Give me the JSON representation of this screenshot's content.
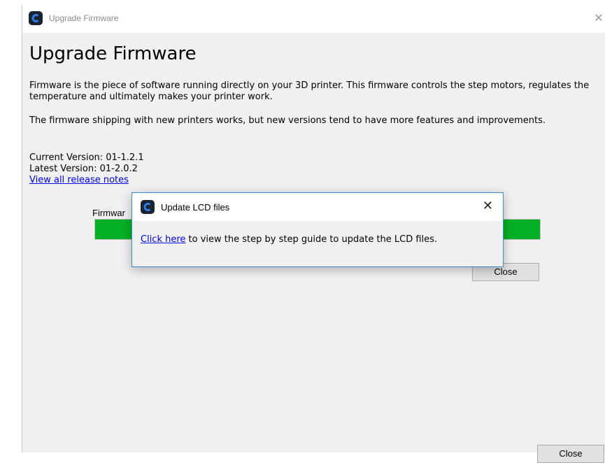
{
  "window": {
    "title": "Upgrade Firmware",
    "close_glyph": "✕"
  },
  "content": {
    "heading": "Upgrade Firmware",
    "paragraph1": "Firmware is the piece of software running directly on your 3D printer. This firmware controls the step motors, regulates the temperature and ultimately makes your printer work.",
    "paragraph2": "The firmware shipping with new printers works, but new versions tend to have more features and improvements.",
    "current_version": "Current Version: 01-1.2.1",
    "latest_version": "Latest Version: 01-2.0.2",
    "release_notes_link": "View all release notes",
    "firmware_label": "Firmwar",
    "progress_fraction": 1.0,
    "inner_close_label": "Close",
    "close_label": "Close"
  },
  "dialog": {
    "title": "Update LCD files",
    "close_glyph": "✕",
    "link_text": "Click here",
    "message_rest": " to view the step by step guide to update the LCD files."
  },
  "colors": {
    "progress_fill": "#06b025",
    "link": "#0000ee",
    "dialog_border": "#3c8fd6",
    "icon": "#1a2330"
  },
  "icons": {
    "app": "app-logo-icon",
    "close": "close-icon"
  }
}
